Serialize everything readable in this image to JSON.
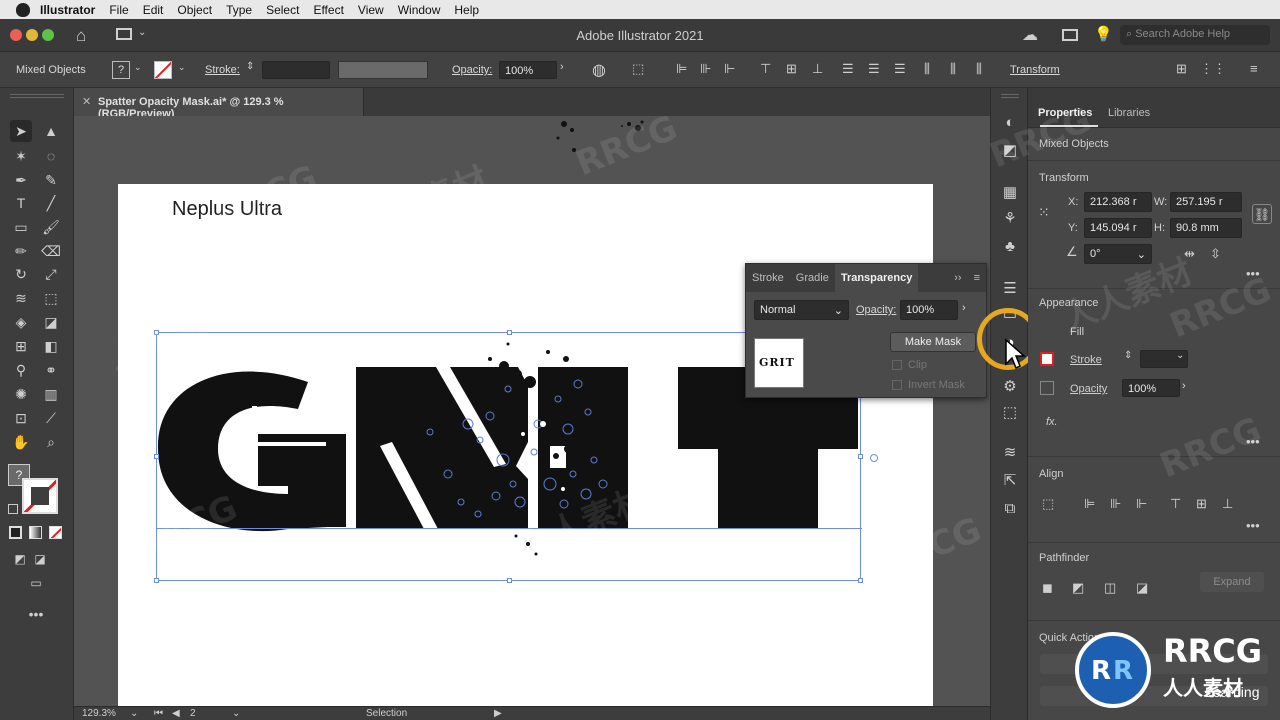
{
  "menubar": {
    "app": "Illustrator",
    "items": [
      "File",
      "Edit",
      "Object",
      "Type",
      "Select",
      "Effect",
      "View",
      "Window",
      "Help"
    ]
  },
  "titlebar": {
    "title": "Adobe Illustrator 2021",
    "search_placeholder": "Search Adobe Help"
  },
  "controlbar": {
    "selection": "Mixed Objects",
    "stroke_label": "Stroke:",
    "opacity_label": "Opacity:",
    "opacity_value": "100%",
    "transform_label": "Transform"
  },
  "document": {
    "tab_title": "Spatter Opacity Mask.ai* @ 129.3 % (RGB/Preview)",
    "close": "✕",
    "caption": "Neplus Ultra"
  },
  "transparency_panel": {
    "tabs": [
      "Stroke",
      "Gradie",
      "Transparency"
    ],
    "active_tab": "Transparency",
    "blend_mode": "Normal",
    "opacity_label": "Opacity:",
    "opacity_value": "100%",
    "make_mask": "Make Mask",
    "clip": "Clip",
    "invert_mask": "Invert Mask",
    "thumbnail_text": "GRIT"
  },
  "properties": {
    "tabs": [
      "Properties",
      "Libraries"
    ],
    "selection": "Mixed Objects",
    "transform": {
      "title": "Transform",
      "x_label": "X:",
      "x": "212.368 r",
      "y_label": "Y:",
      "y": "145.094 r",
      "w_label": "W:",
      "w": "257.195 r",
      "h_label": "H:",
      "h": "90.8 mm",
      "angle": "0°"
    },
    "appearance": {
      "title": "Appearance",
      "fill": "Fill",
      "stroke": "Stroke",
      "opacity": "Opacity",
      "opacity_value": "100%",
      "fx": "fx."
    },
    "align": {
      "title": "Align"
    },
    "pathfinder": {
      "title": "Pathfinder",
      "expand": "Expand"
    },
    "quick_actions": {
      "title": "Quick Actions"
    }
  },
  "statusbar": {
    "zoom": "129.3%",
    "artboard": "2",
    "tool": "Selection"
  },
  "watermark": {
    "text": "RRCG",
    "brand_big": "RRCG",
    "brand_small": "人人素材",
    "brand_sub": "Learning",
    "cn": "人人素材"
  },
  "colors": {
    "accent_highlight": "#e8a720",
    "selection_blue": "#5b7bd6"
  }
}
